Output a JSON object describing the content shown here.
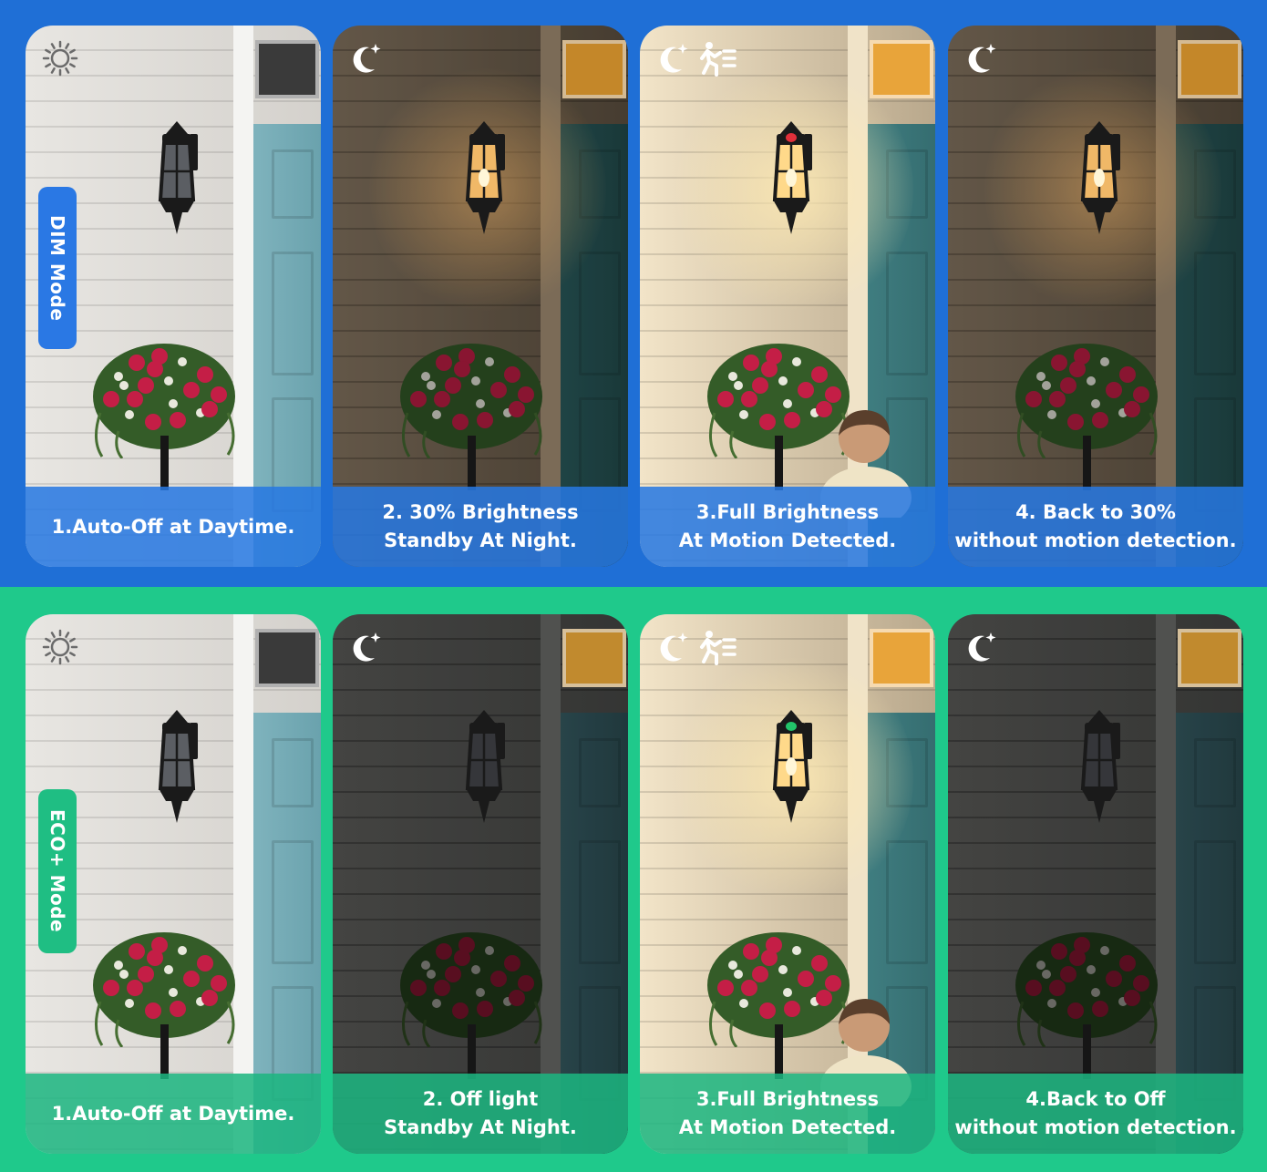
{
  "colors": {
    "dim_bg": "#1f6fd6",
    "eco_bg": "#1fc98b",
    "dim_pill": "#2a78e4",
    "eco_pill": "#1fbe83",
    "dim_caption": "rgba(38,120,226,0.86)",
    "eco_caption": "rgba(28,182,128,0.86)"
  },
  "dim_mode": {
    "label": "DIM Mode",
    "cards": [
      {
        "icons": [
          "sun-icon"
        ],
        "scene": "day",
        "caption": [
          "1.Auto-Off at Daytime."
        ]
      },
      {
        "icons": [
          "moon-icon"
        ],
        "scene": "dim",
        "caption": [
          "2. 30% Brightness",
          "Standby At Night."
        ]
      },
      {
        "icons": [
          "moon-icon",
          "motion-icon"
        ],
        "scene": "full",
        "caption": [
          "3.Full Brightness",
          "At  Motion Detected."
        ]
      },
      {
        "icons": [
          "moon-icon"
        ],
        "scene": "dim",
        "caption": [
          "4. Back to 30%",
          "without motion detection."
        ]
      }
    ]
  },
  "eco_mode": {
    "label": "ECO+ Mode",
    "cards": [
      {
        "icons": [
          "sun-icon"
        ],
        "scene": "day",
        "caption": [
          "1.Auto-Off at Daytime."
        ]
      },
      {
        "icons": [
          "moon-icon"
        ],
        "scene": "off",
        "caption": [
          "2. Off light",
          "Standby At Night."
        ]
      },
      {
        "icons": [
          "moon-icon",
          "motion-icon"
        ],
        "scene": "full",
        "caption": [
          "3.Full Brightness",
          "At  Motion Detected."
        ]
      },
      {
        "icons": [
          "moon-icon"
        ],
        "scene": "off",
        "caption": [
          "4.Back to Off",
          "without motion detection."
        ]
      }
    ]
  }
}
